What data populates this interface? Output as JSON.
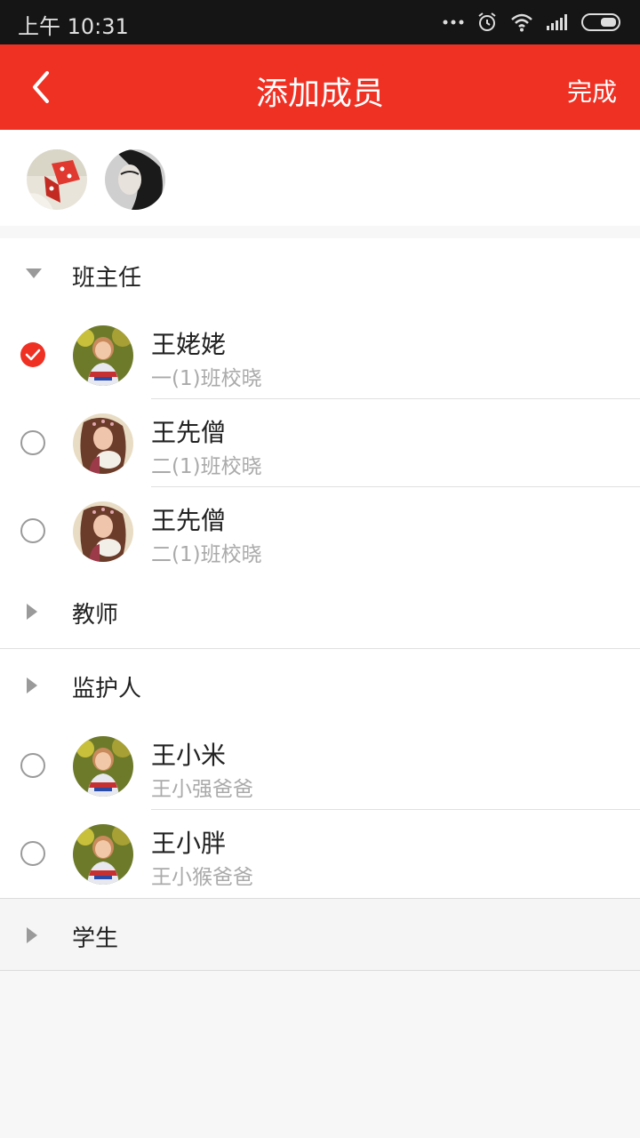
{
  "status_bar": {
    "time": "上午 10:31",
    "icons": [
      "more-dots-icon",
      "alarm-icon",
      "wifi-icon",
      "signal-icon",
      "battery-icon"
    ]
  },
  "header": {
    "title": "添加成员",
    "done_label": "完成",
    "back_icon": "chevron-left-icon",
    "background": "#ef3124"
  },
  "selected_members": [
    {
      "avatar": "dice-photo"
    },
    {
      "avatar": "woman-photo"
    }
  ],
  "groups": [
    {
      "name": "班主任",
      "expanded": true,
      "members": [
        {
          "name": "王姥姥",
          "sub": "一(1)班校晓",
          "checked": true
        },
        {
          "name": "王先僧",
          "sub": "二(1)班校晓",
          "checked": false
        },
        {
          "name": "王先僧",
          "sub": "二(1)班校晓",
          "checked": false
        }
      ]
    },
    {
      "name": "教师",
      "expanded": false,
      "members": []
    },
    {
      "name": "监护人",
      "expanded": true,
      "members": [
        {
          "name": "王小米",
          "sub": "王小强爸爸",
          "checked": false
        },
        {
          "name": "王小胖",
          "sub": "王小猴爸爸",
          "checked": false
        }
      ]
    },
    {
      "name": "学生",
      "expanded": false,
      "members": []
    }
  ],
  "colors": {
    "accent": "#ef3124",
    "status_bar": "#151515"
  }
}
